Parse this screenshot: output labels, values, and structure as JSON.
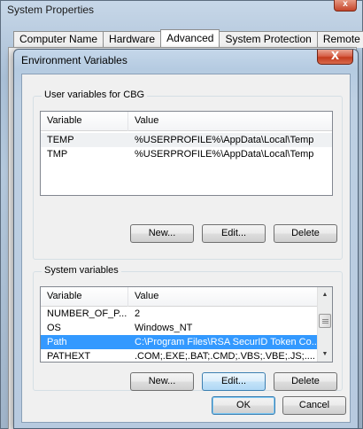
{
  "system_properties": {
    "title": "System Properties",
    "close_glyph": "x",
    "tabs": [
      {
        "label": "Computer Name"
      },
      {
        "label": "Hardware"
      },
      {
        "label": "Advanced"
      },
      {
        "label": "System Protection"
      },
      {
        "label": "Remote"
      }
    ],
    "active_tab": "Advanced"
  },
  "env_dialog": {
    "title": "Environment Variables",
    "close_glyph": "X",
    "user_vars": {
      "group_label": "User variables for CBG",
      "columns": [
        "Variable",
        "Value"
      ],
      "rows": [
        {
          "variable": "TEMP",
          "value": "%USERPROFILE%\\AppData\\Local\\Temp"
        },
        {
          "variable": "TMP",
          "value": "%USERPROFILE%\\AppData\\Local\\Temp"
        }
      ],
      "buttons": {
        "new": "New...",
        "edit": "Edit...",
        "delete": "Delete"
      }
    },
    "system_vars": {
      "group_label": "System variables",
      "columns": [
        "Variable",
        "Value"
      ],
      "rows": [
        {
          "variable": "NUMBER_OF_P...",
          "value": "2"
        },
        {
          "variable": "OS",
          "value": "Windows_NT"
        },
        {
          "variable": "Path",
          "value": "C:\\Program Files\\RSA SecurID Token Co...",
          "selected": true
        },
        {
          "variable": "PATHEXT",
          "value": ".COM;.EXE;.BAT;.CMD;.VBS;.VBE;.JS;...."
        }
      ],
      "buttons": {
        "new": "New...",
        "edit": "Edit...",
        "delete": "Delete"
      }
    },
    "ok_label": "OK",
    "cancel_label": "Cancel"
  },
  "colors": {
    "selection": "#3399ff",
    "close_button": "#c43c1e",
    "focus_border": "#3c7fb1"
  },
  "icons": {
    "scroll_up": "scroll-up-arrow-icon",
    "scroll_down": "scroll-down-arrow-icon"
  }
}
